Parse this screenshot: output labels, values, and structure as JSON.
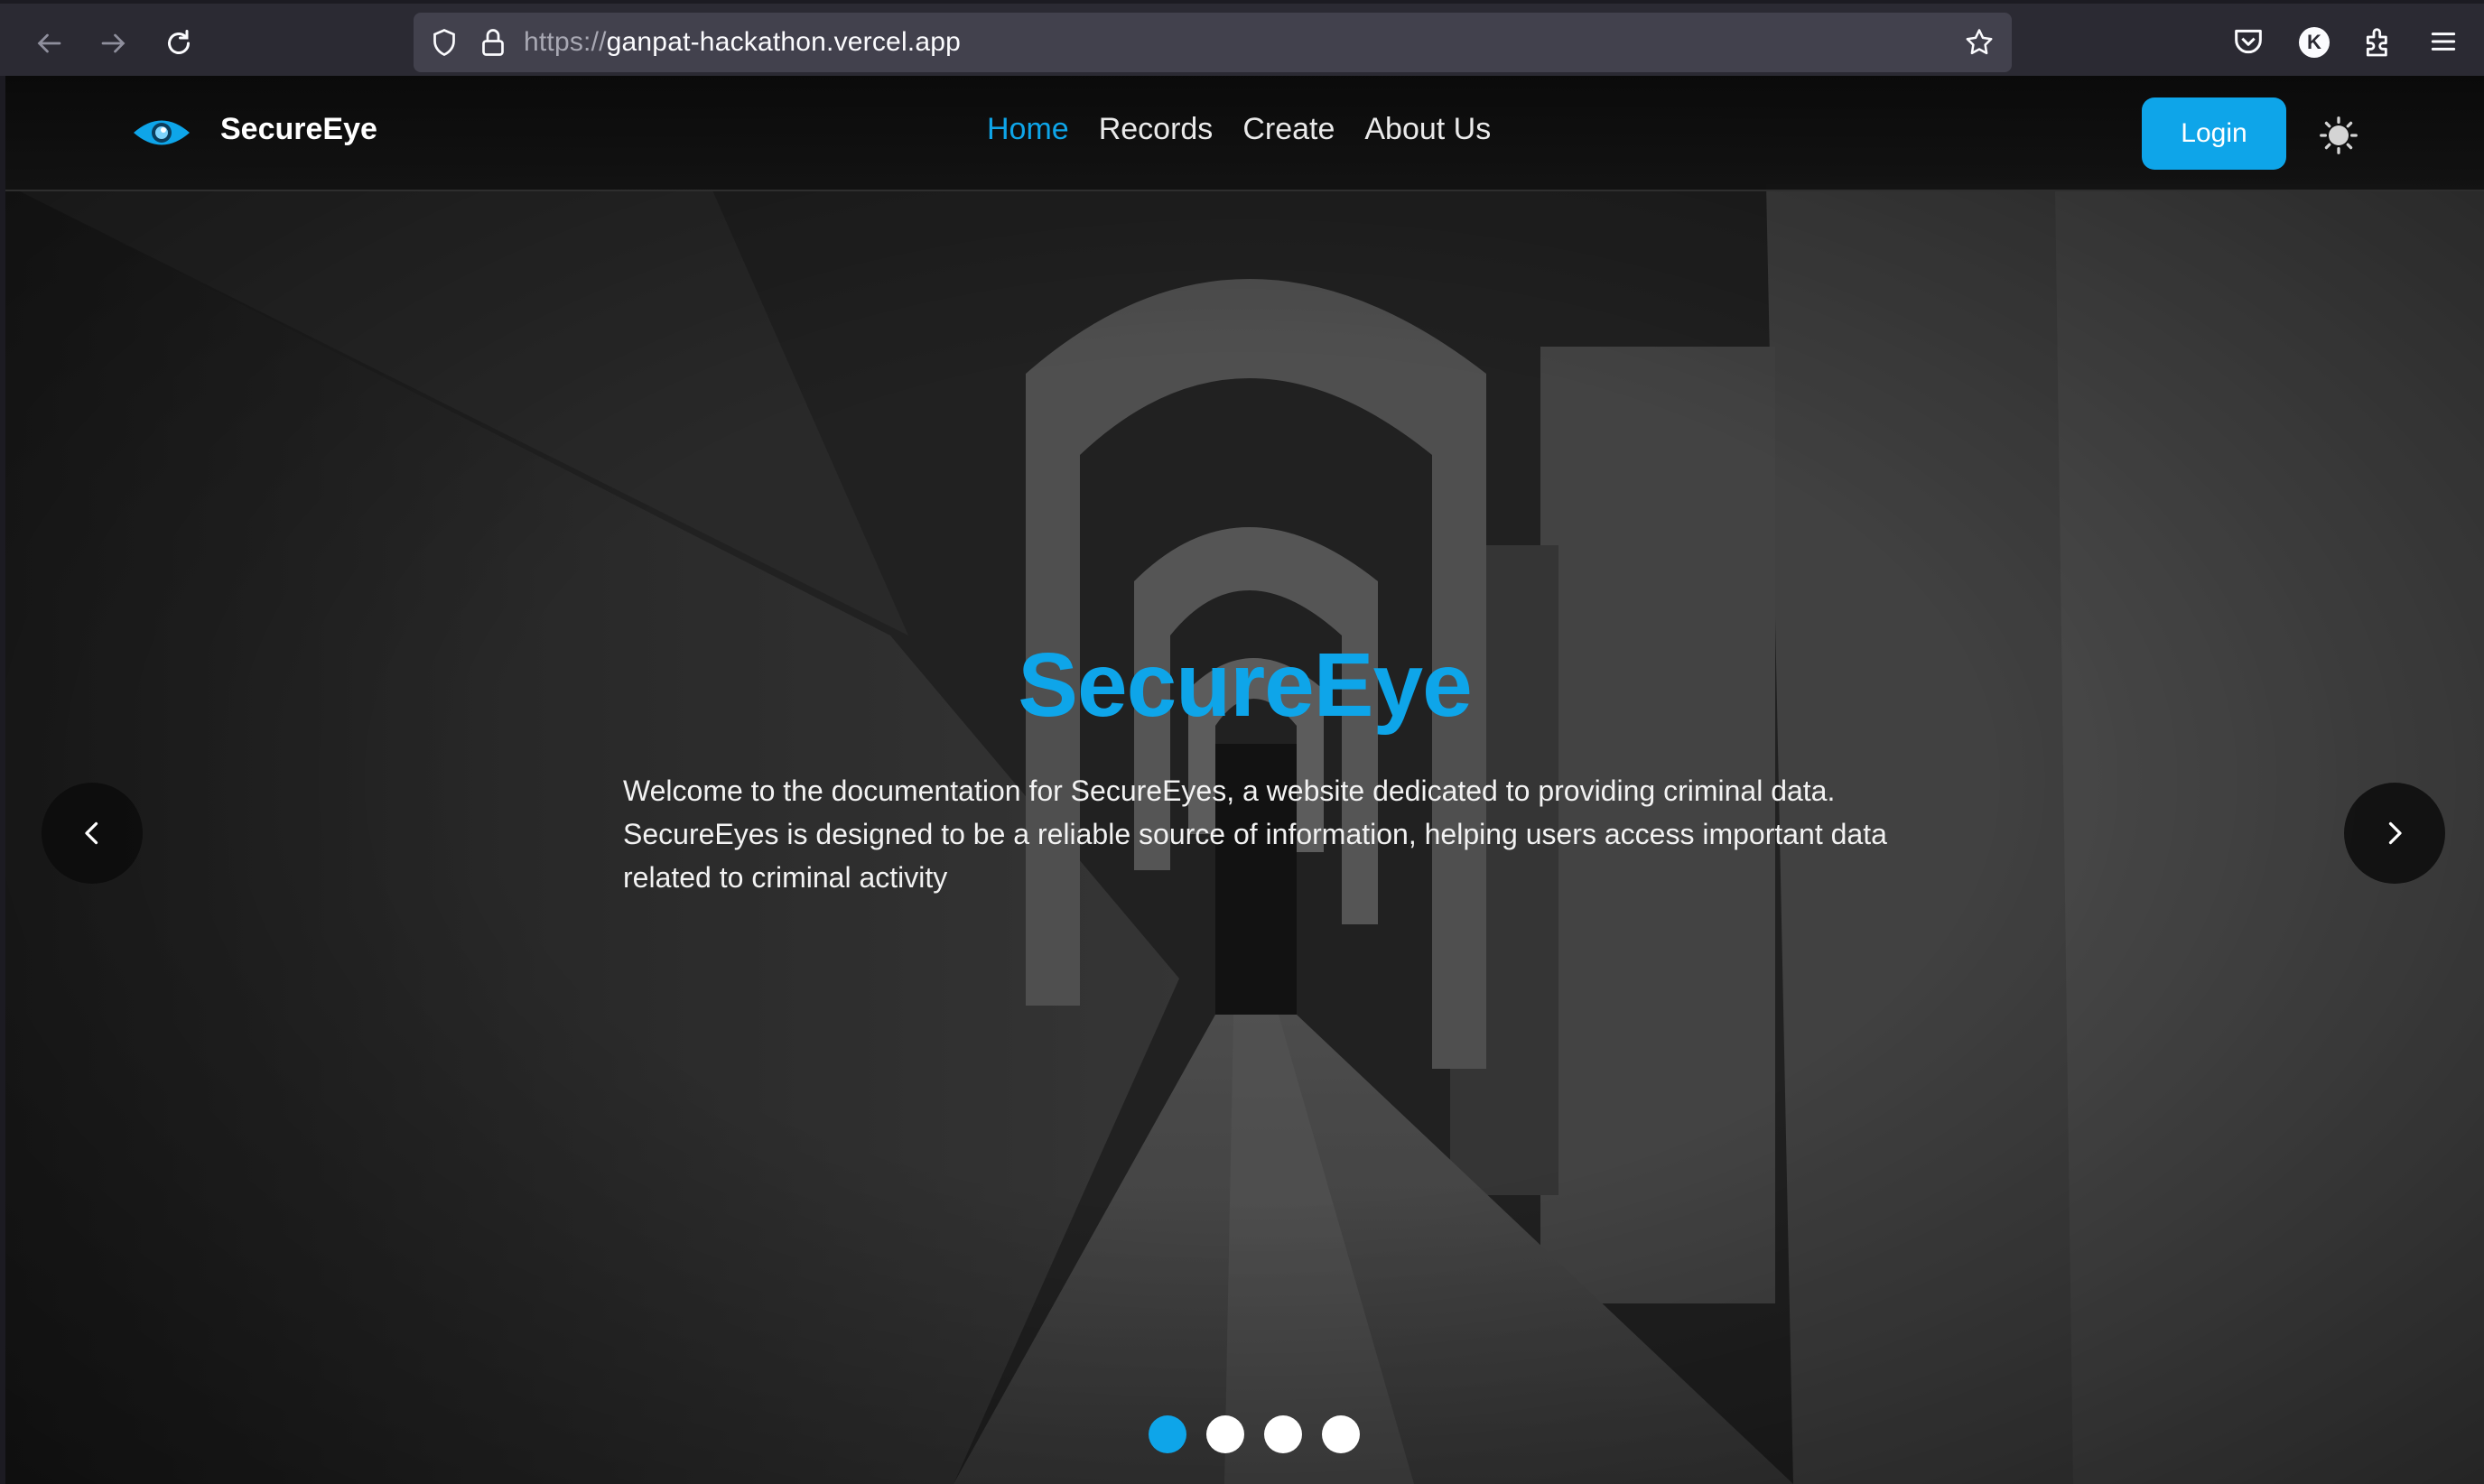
{
  "browser": {
    "url_protocol": "https://",
    "url_host": "ganpat-hackathon.vercel.app",
    "profile_initial": "K"
  },
  "site": {
    "brand": "SecureEye",
    "nav": [
      "Home",
      "Records",
      "Create",
      "About Us"
    ],
    "active_nav": "Home",
    "login_label": "Login",
    "accent_color": "#0ea5e9"
  },
  "hero": {
    "title": "SecureEye",
    "text": "Welcome to the documentation for SecureEyes, a website dedicated to providing criminal data. SecureEyes is designed to be a reliable source of information, helping users access important data related to criminal activity",
    "slide_count": 4,
    "active_slide": 1
  },
  "icons": {
    "back": "arrow-left-icon",
    "forward": "arrow-right-icon",
    "reload": "reload-icon",
    "shield": "shield-icon",
    "lock": "lock-icon",
    "bookmark": "star-icon",
    "pocket": "pocket-icon",
    "extensions": "puzzle-icon",
    "menu": "hamburger-icon",
    "logo": "eye-icon",
    "theme": "sun-icon",
    "prev": "chevron-left-icon",
    "next": "chevron-right-icon"
  }
}
